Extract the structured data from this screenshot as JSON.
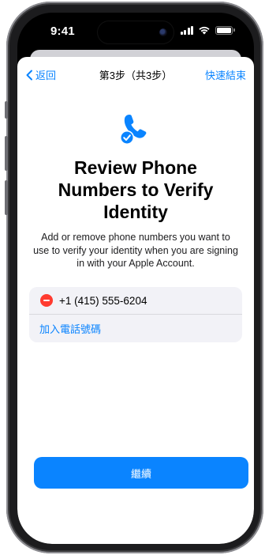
{
  "status": {
    "time": "9:41"
  },
  "nav": {
    "back_label": "返回",
    "title": "第3步（共3步）",
    "done_label": "快速結束"
  },
  "hero": {
    "icon": "phone-checkmark-icon"
  },
  "content": {
    "title": "Review Phone Numbers to Verify Identity",
    "description": "Add or remove phone numbers you want to use to verify your identity when you are signing in with your Apple Account."
  },
  "phones": {
    "items": [
      {
        "number": "+1 (415) 555-6204"
      }
    ],
    "add_label": "加入電話號碼"
  },
  "footer": {
    "continue_label": "繼續"
  },
  "colors": {
    "accent": "#0a84ff",
    "destructive": "#ff3b30",
    "group_background": "#f2f2f7"
  }
}
